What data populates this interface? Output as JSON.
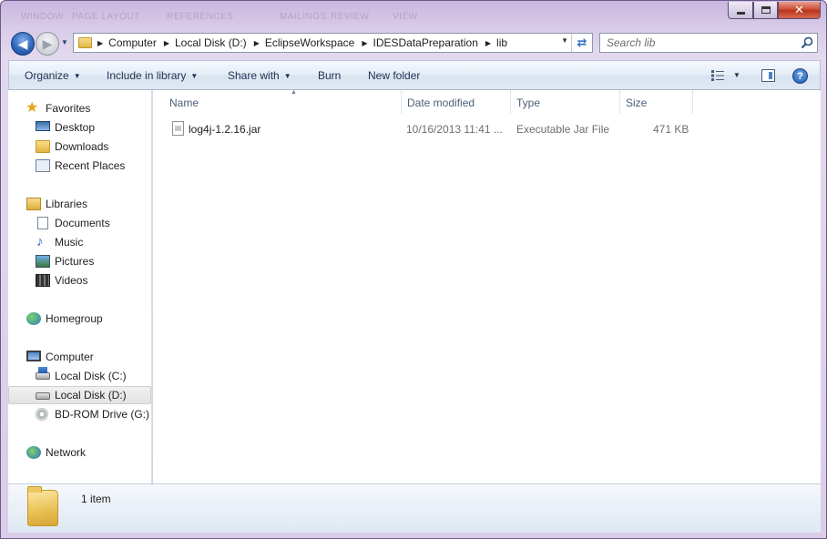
{
  "window": {
    "ghost_tabs": [
      "WINDOW",
      "PAGE LAYOUT",
      "REFERENCES",
      "MAILINGS",
      "REVIEW",
      "VIEW"
    ]
  },
  "nav": {
    "breadcrumbs": [
      "Computer",
      "Local Disk (D:)",
      "EclipseWorkspace",
      "IDESDataPreparation",
      "lib"
    ],
    "search_placeholder": "Search lib"
  },
  "toolbar": {
    "organize": "Organize",
    "include_in_library": "Include in library",
    "share_with": "Share with",
    "burn": "Burn",
    "new_folder": "New folder",
    "help": "?"
  },
  "sidebar": {
    "favorites": {
      "label": "Favorites",
      "items": [
        "Desktop",
        "Downloads",
        "Recent Places"
      ]
    },
    "libraries": {
      "label": "Libraries",
      "items": [
        "Documents",
        "Music",
        "Pictures",
        "Videos"
      ]
    },
    "homegroup": {
      "label": "Homegroup"
    },
    "computer": {
      "label": "Computer",
      "items": [
        "Local Disk (C:)",
        "Local Disk (D:)",
        "BD-ROM Drive (G:)"
      ]
    },
    "network": {
      "label": "Network"
    },
    "selected": "Local Disk (D:)"
  },
  "columns": [
    "Name",
    "Date modified",
    "Type",
    "Size"
  ],
  "files": [
    {
      "name": "log4j-1.2.16.jar",
      "date_modified": "10/16/2013 11:41 ...",
      "type": "Executable Jar File",
      "size": "471 KB"
    }
  ],
  "status": {
    "item_count": "1 item"
  },
  "colors": {
    "frame": "#d8cbe8",
    "command_bar": "#dfe8f3",
    "header_text": "#4c607a",
    "link_blue": "#1e3250"
  }
}
